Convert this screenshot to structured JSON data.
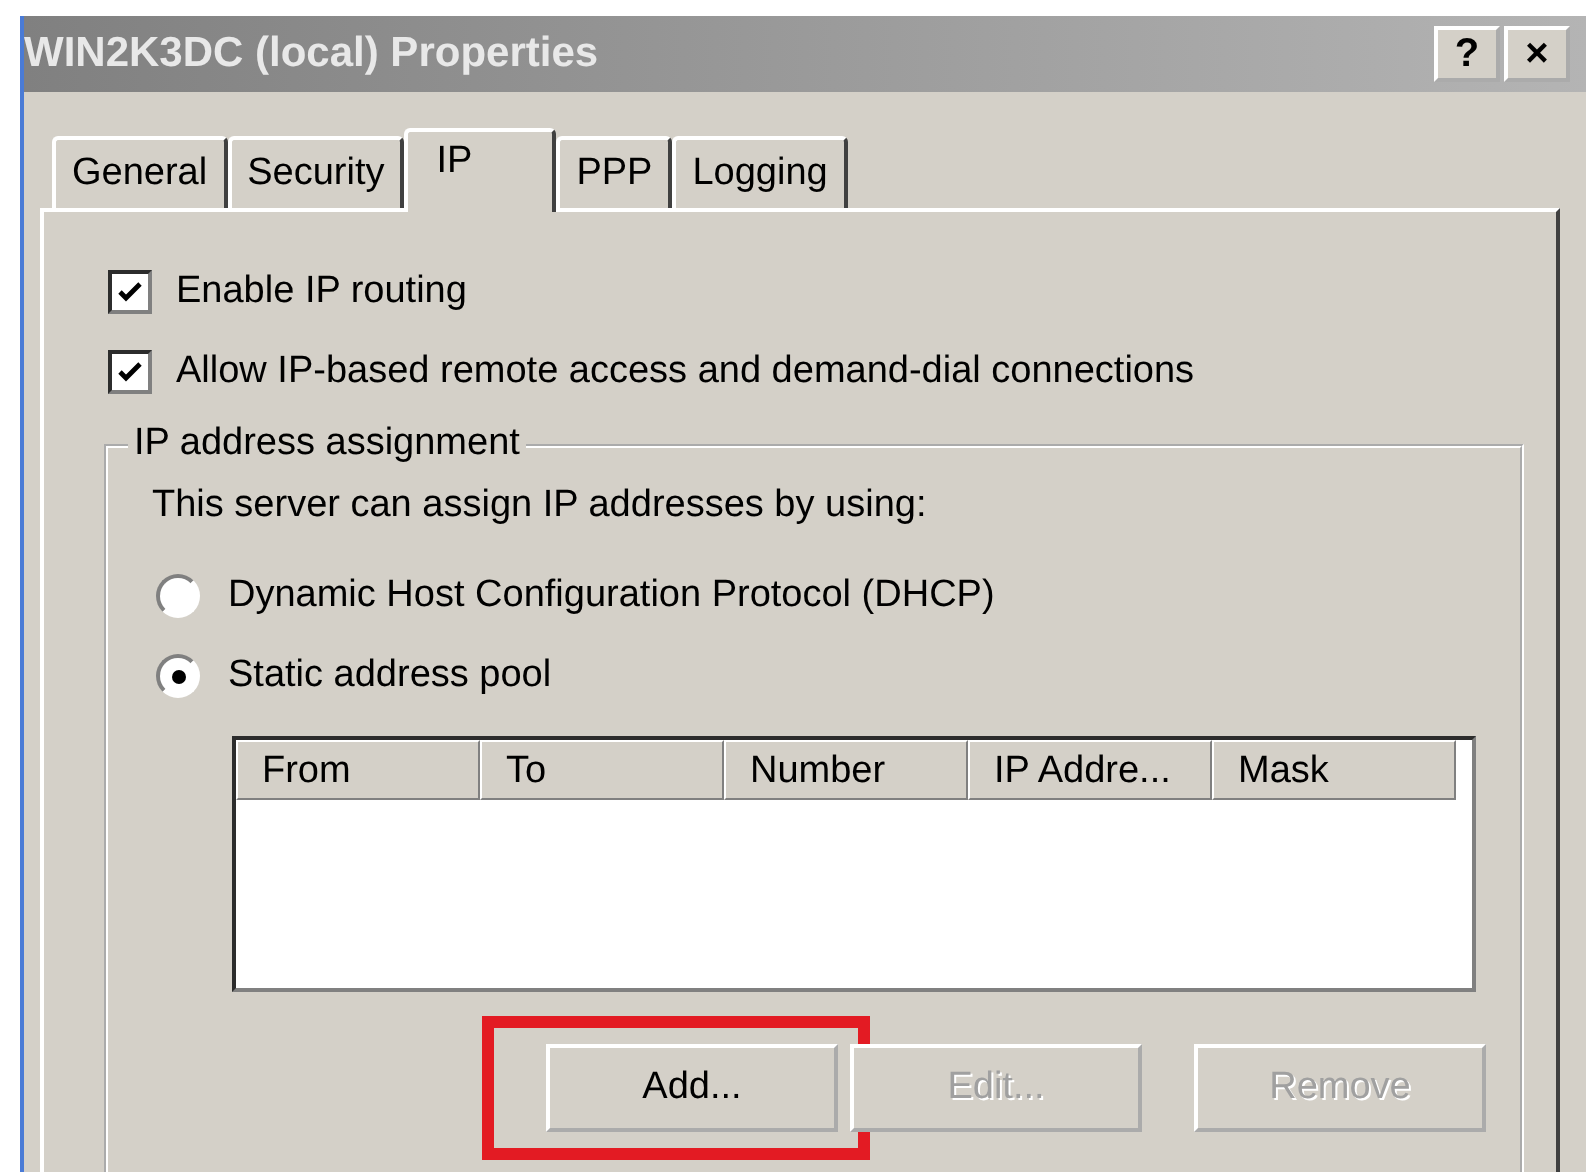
{
  "window": {
    "title": "WIN2K3DC (local) Properties",
    "title_buttons": [
      "?",
      "×"
    ]
  },
  "tabs": [
    {
      "label": "General",
      "selected": false
    },
    {
      "label": "Security",
      "selected": false
    },
    {
      "label": "IP",
      "selected": true
    },
    {
      "label": "PPP",
      "selected": false
    },
    {
      "label": "Logging",
      "selected": false
    }
  ],
  "checkboxes": [
    {
      "label": "Enable IP routing",
      "checked": true
    },
    {
      "label": "Allow IP-based remote access and demand-dial connections",
      "checked": true
    }
  ],
  "group": {
    "title": "IP address assignment",
    "prompt": "This server can assign IP addresses by using:",
    "radios": [
      {
        "label": "Dynamic Host Configuration Protocol (DHCP)",
        "selected": false
      },
      {
        "label": "Static address pool",
        "selected": true
      }
    ],
    "table": {
      "columns": [
        "From",
        "To",
        "Number",
        "IP Addre...",
        "Mask"
      ]
    },
    "buttons": [
      {
        "label": "Add...",
        "disabled": false,
        "highlighted": true
      },
      {
        "label": "Edit...",
        "disabled": true,
        "highlighted": false
      },
      {
        "label": "Remove",
        "disabled": true,
        "highlighted": false
      }
    ]
  }
}
